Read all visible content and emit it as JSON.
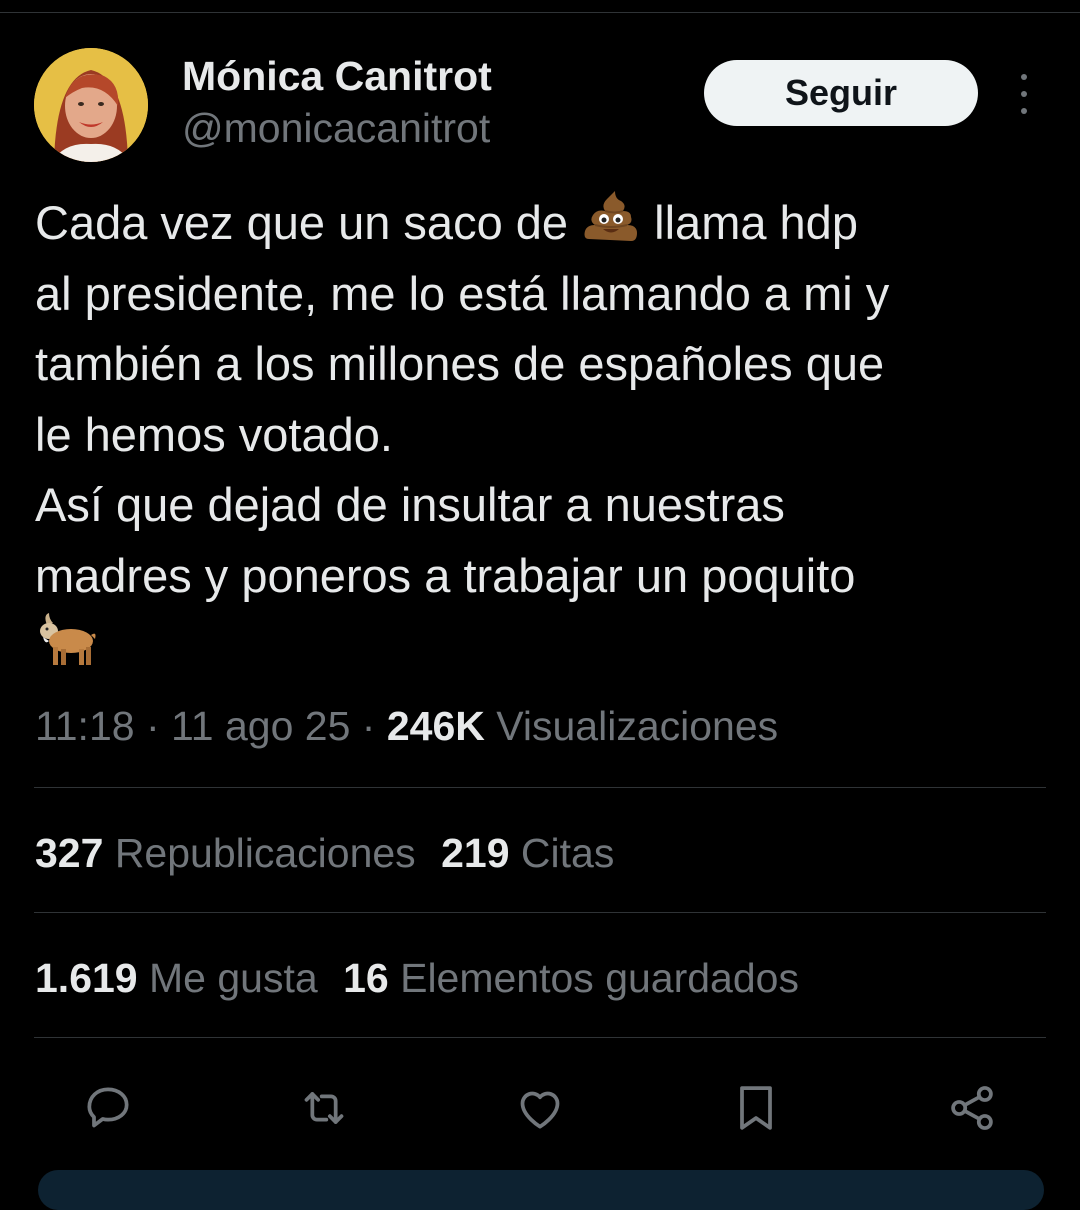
{
  "author": {
    "display_name": "Mónica Canitrot",
    "handle": "@monicacanitrot"
  },
  "follow_label": "Seguir",
  "tweet": {
    "lines": [
      "Cada vez que un  saco de",
      "llama hdp",
      "al presidente, me lo está llamando a mi y",
      "también a los millones de españoles que",
      "le hemos votado.",
      "Así que dejad de insultar a nuestras",
      "madres y poneros a trabajar un poquito"
    ],
    "emojis": [
      "poop-emoji",
      "goat-emoji"
    ]
  },
  "meta": {
    "time": "11:18",
    "date": "11 ago 25",
    "separator": "·",
    "views_count": "246K",
    "views_label": "Visualizaciones"
  },
  "stats": {
    "reposts_count": "327",
    "reposts_label": "Republicaciones",
    "quotes_count": "219",
    "quotes_label": "Citas",
    "likes_count": "1.619",
    "likes_label": "Me gusta",
    "bookmarks_count": "16",
    "bookmarks_label": "Elementos guardados"
  },
  "actions": [
    "reply-icon",
    "repost-icon",
    "like-icon",
    "bookmark-icon",
    "share-icon"
  ],
  "colors": {
    "background": "#000000",
    "text": "#e7e9ea",
    "secondary": "#71767b",
    "divider": "#2f3336",
    "button_bg": "#eff3f4"
  }
}
